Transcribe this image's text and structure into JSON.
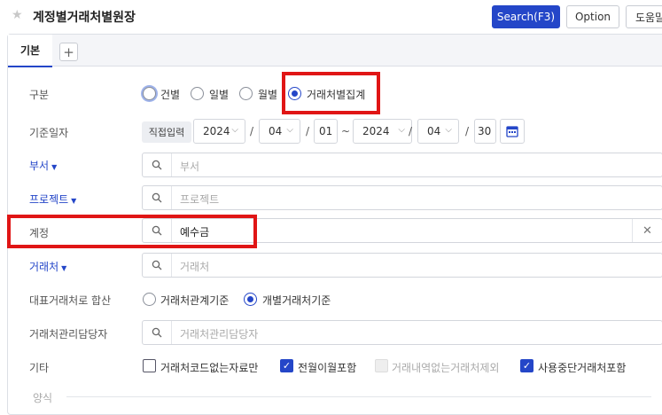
{
  "header": {
    "title": "계정별거래처별원장",
    "search_label": "Search(F3)",
    "option_label": "Option",
    "help_label": "도움말"
  },
  "tabs": {
    "basic": "기본",
    "add": "+"
  },
  "form": {
    "category": {
      "label": "구분",
      "options": [
        "건별",
        "일별",
        "월별",
        "거래처별집계"
      ],
      "selected": "거래처별집계"
    },
    "date": {
      "label": "기준일자",
      "mode": "직접입력",
      "from": {
        "year": "2024",
        "month": "04",
        "day": "01"
      },
      "tilde": "~",
      "to": {
        "year": "2024",
        "month": "04",
        "day": "30"
      },
      "slash": "/"
    },
    "department": {
      "label": "부서",
      "placeholder": "부서"
    },
    "project": {
      "label": "프로젝트",
      "placeholder": "프로젝트"
    },
    "account": {
      "label": "계정",
      "value": "예수금"
    },
    "client": {
      "label": "거래처",
      "placeholder": "거래처"
    },
    "rep_client": {
      "label": "대표거래처로 합산",
      "options": [
        "거래처관계기준",
        "개별거래처기준"
      ],
      "selected": "개별거래처기준"
    },
    "manager": {
      "label": "거래처관리담당자",
      "placeholder": "거래처관리담당자"
    },
    "etc": {
      "label": "기타",
      "options": [
        {
          "label": "거래처코드없는자료만",
          "checked": false,
          "disabled": false
        },
        {
          "label": "전월이월포함",
          "checked": true,
          "disabled": false
        },
        {
          "label": "거래내역없는거래처제외",
          "checked": false,
          "disabled": true
        },
        {
          "label": "사용중단거래처포함",
          "checked": true,
          "disabled": false
        }
      ]
    },
    "format": {
      "label": "양식"
    }
  },
  "colors": {
    "primary": "#2446c8",
    "highlight": "#e01515"
  }
}
